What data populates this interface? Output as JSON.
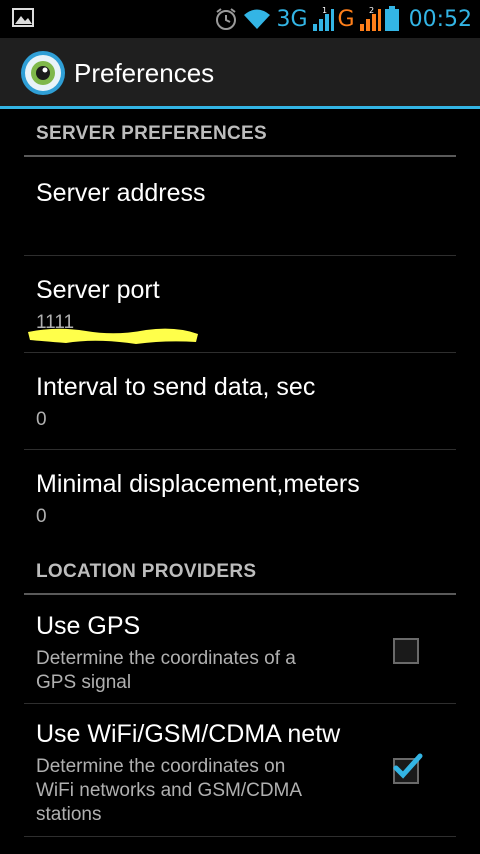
{
  "status_bar": {
    "network_type": "3G",
    "network_type_2": "G",
    "sim1_label": "1",
    "sim2_label": "2",
    "time": "00:52",
    "accent_color": "#33b5e5",
    "secondary_color": "#ff7f1a",
    "icons": [
      "image-icon",
      "alarm-icon",
      "wifi-icon",
      "signal-icon",
      "signal-icon",
      "battery-icon"
    ]
  },
  "action_bar": {
    "title": "Preferences",
    "app_icon": "eye-logo-icon"
  },
  "sections": {
    "server": {
      "header": "SERVER PREFERENCES",
      "items": [
        {
          "title": "Server address",
          "summary": ""
        },
        {
          "title": "Server port",
          "summary": "1111"
        },
        {
          "title": "Interval to send data, sec",
          "summary": "0"
        },
        {
          "title": "Minimal displacement,meters",
          "summary": "0"
        }
      ]
    },
    "location": {
      "header": "LOCATION PROVIDERS",
      "items": [
        {
          "title": "Use GPS",
          "summary_line1": "Determine the coordinates of a",
          "summary_line2": "GPS signal",
          "checked": false
        },
        {
          "title": "Use WiFi/GSM/CDMA netw",
          "summary_line1": "Determine the coordinates on",
          "summary_line2": "WiFi networks and GSM/CDMA",
          "summary_line3": "stations",
          "checked": true
        }
      ]
    }
  }
}
